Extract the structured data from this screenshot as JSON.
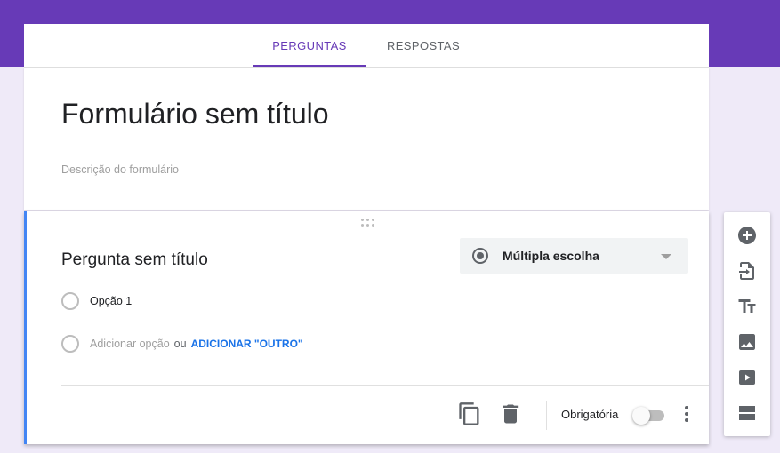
{
  "tabs": [
    {
      "label": "PERGUNTAS",
      "active": true
    },
    {
      "label": "RESPOSTAS",
      "active": false
    }
  ],
  "form": {
    "title": "Formulário sem título",
    "description": "Descrição do formulário"
  },
  "question": {
    "title": "Pergunta sem título",
    "type": "Múltipla escolha",
    "options": [
      "Opção 1"
    ],
    "add_option_label": "Adicionar opção",
    "or_label": "ou",
    "add_other_label": "ADICIONAR \"OUTRO\"",
    "required_label": "Obrigatória",
    "required": false
  },
  "icons": {
    "footer": [
      "duplicate-icon",
      "delete-icon",
      "more-vert-icon"
    ],
    "toolbar": [
      "add-question-icon",
      "import-questions-icon",
      "title-text-icon",
      "image-icon",
      "video-icon",
      "section-icon"
    ]
  },
  "colors": {
    "header": "#673ab7",
    "active_tab": "#673ab7",
    "question_accent": "#4285f4",
    "link": "#1a73e8",
    "background": "#efeaf8"
  }
}
